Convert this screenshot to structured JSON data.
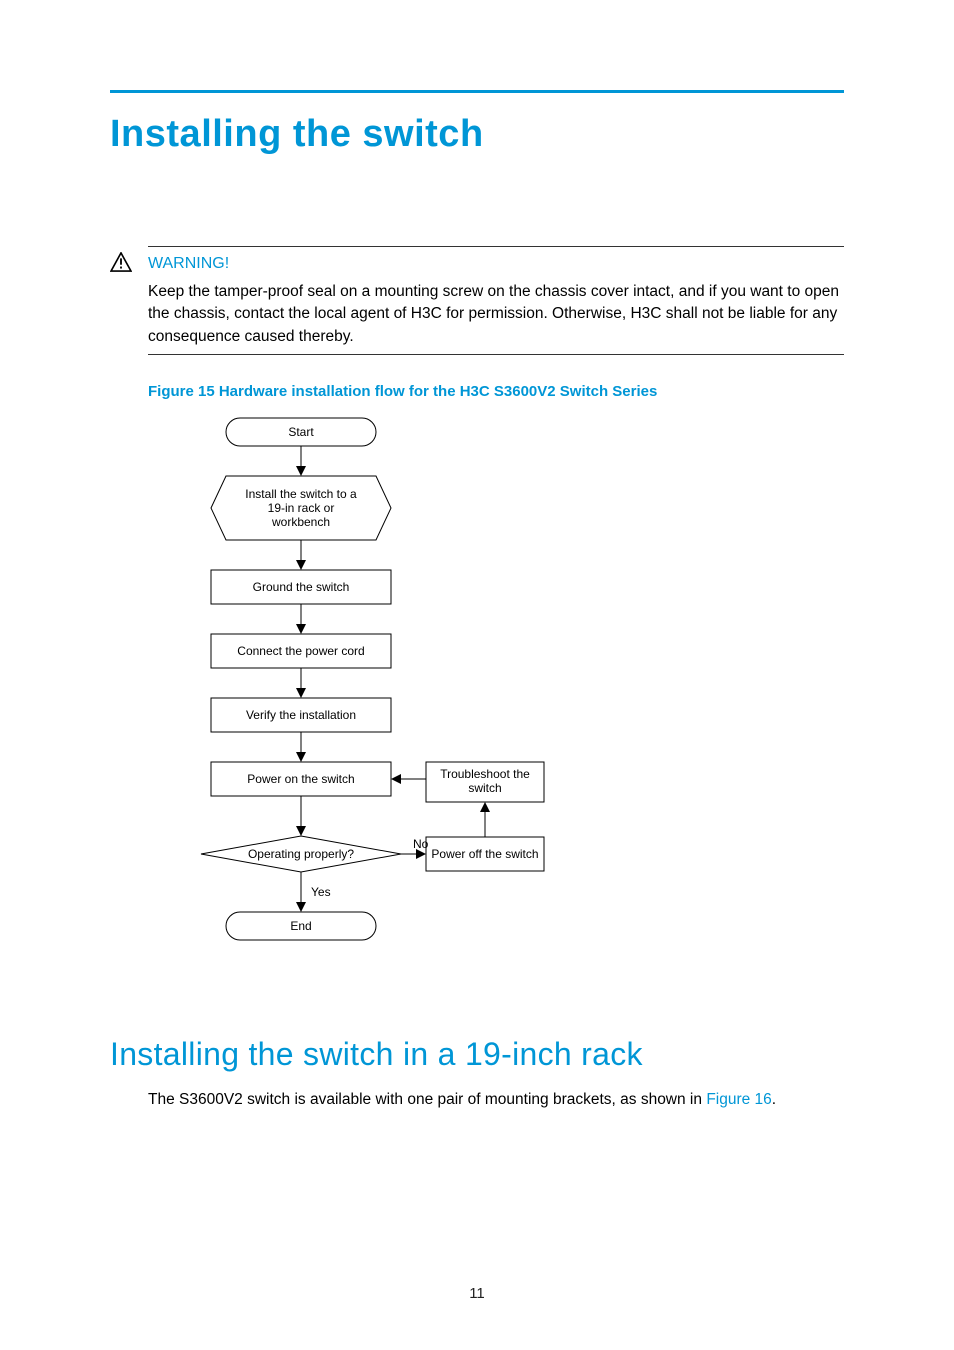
{
  "page": {
    "title": "Installing the switch",
    "number": "11"
  },
  "warning": {
    "label": "WARNING!",
    "body": "Keep the tamper-proof seal on a mounting screw on the chassis cover intact, and if you want to open the chassis, contact the local agent of H3C for permission. Otherwise, H3C shall not be liable for any consequence caused thereby."
  },
  "figure": {
    "caption": "Figure 15 Hardware installation flow for the H3C S3600V2 Switch Series",
    "nodes": {
      "start": "Start",
      "install": "Install the switch to a\n19-in rack or\nworkbench",
      "ground": "Ground the switch",
      "connect": "Connect the power cord",
      "verify": "Verify the installation",
      "poweron": "Power on the switch",
      "troubleshoot": "Troubleshoot the\nswitch",
      "operating": "Operating properly?",
      "poweroff": "Power off the switch",
      "end": "End",
      "no": "No",
      "yes": "Yes"
    }
  },
  "section": {
    "title": "Installing the switch in a 19-inch rack",
    "body_before": "The S3600V2 switch is available with one pair of mounting brackets, as shown in ",
    "figure_link": "Figure 16",
    "body_after": "."
  }
}
